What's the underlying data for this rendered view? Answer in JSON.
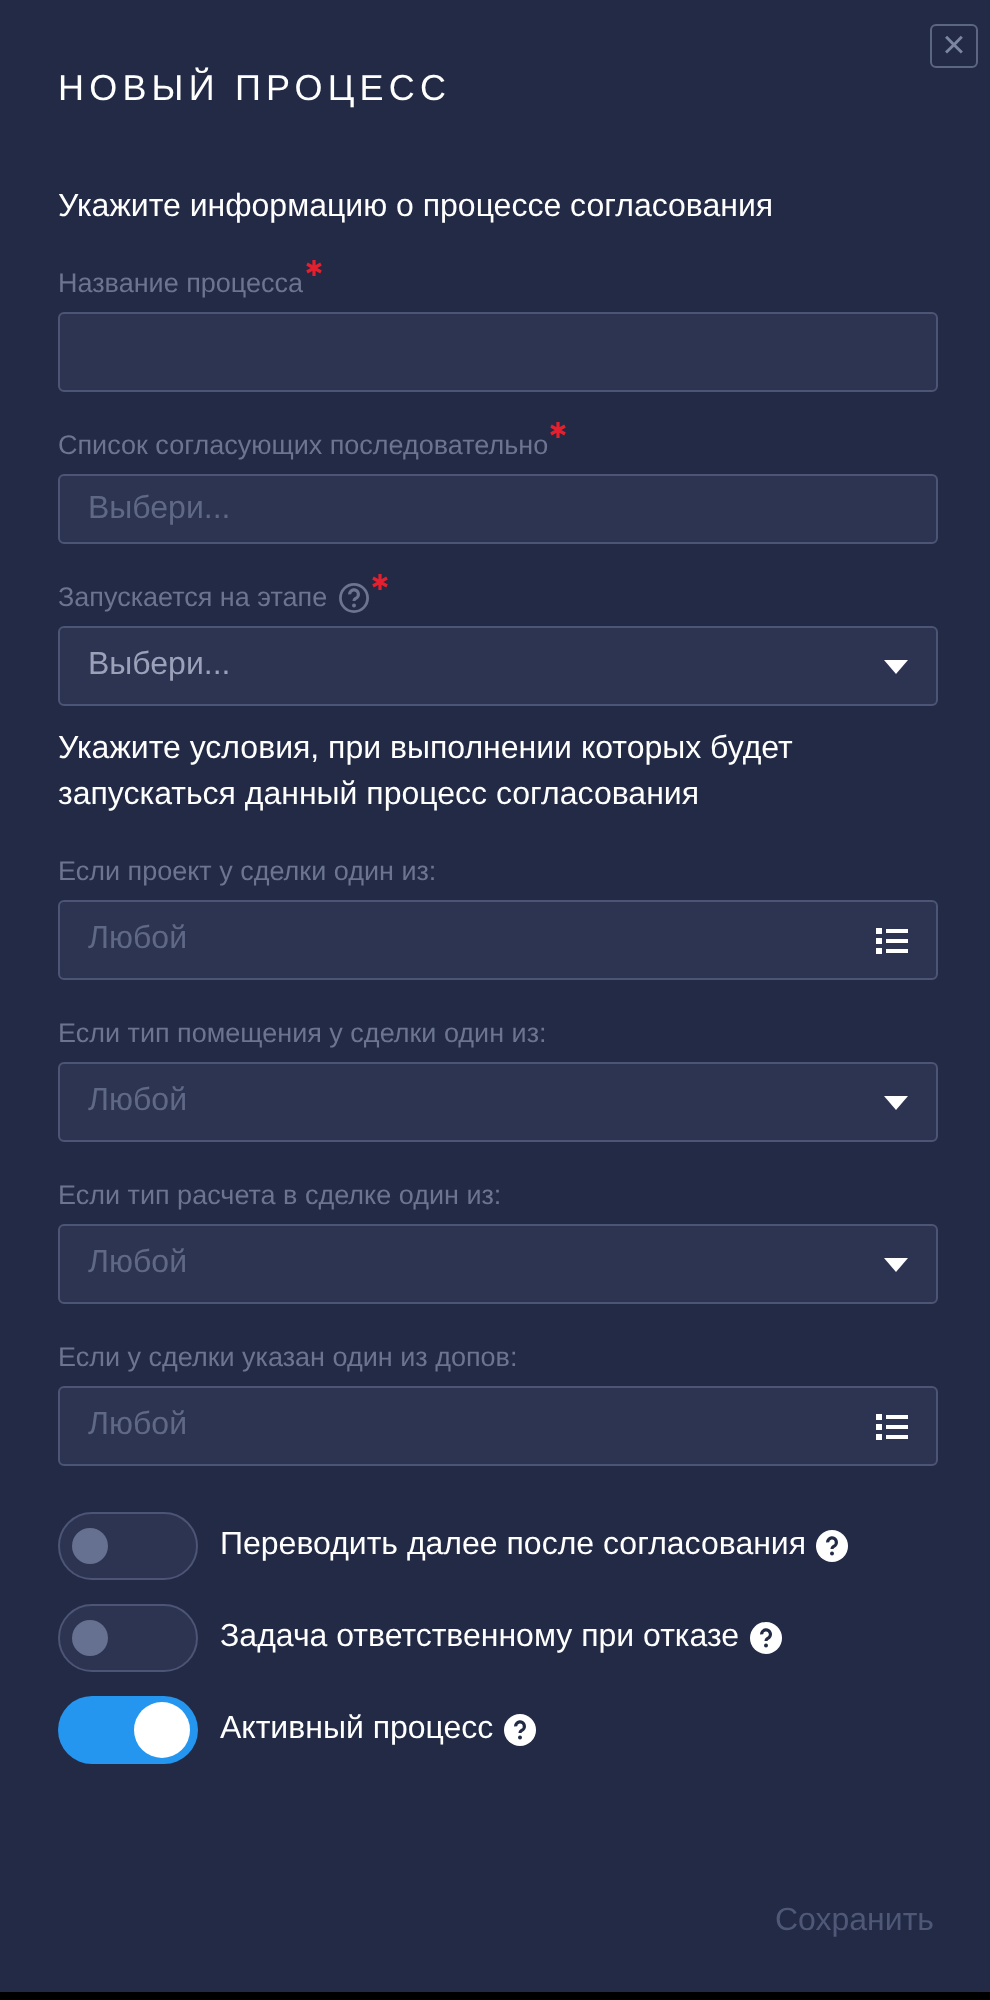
{
  "dialog": {
    "title": "НОВЫЙ ПРОЦЕСС",
    "close_label": "×"
  },
  "sections": [
    {
      "heading": "Укажите информацию о процессе согласования",
      "fields": [
        {
          "kind": "text",
          "label": "Название процесса",
          "required": true,
          "help": false
        },
        {
          "kind": "multi",
          "label": "Список согласующих последовательно",
          "required": true,
          "help": false,
          "placeholder": "Выбери..."
        },
        {
          "kind": "select",
          "label": "Запускается на этапе",
          "required": true,
          "help": true,
          "value": "Выбери..."
        }
      ]
    },
    {
      "heading": "Укажите условия, при выполнении которых будет запускаться данный процесс согласования",
      "fields": [
        {
          "kind": "list",
          "label": "Если проект у сделки один из:",
          "required": false,
          "help": false,
          "placeholder": "Любой"
        },
        {
          "kind": "select",
          "label": "Если тип помещения у сделки один из:",
          "required": false,
          "help": false,
          "placeholder": "Любой"
        },
        {
          "kind": "select",
          "label": "Если тип расчета в сделке один из:",
          "required": false,
          "help": false,
          "placeholder": "Любой"
        },
        {
          "kind": "list",
          "label": "Если у сделки указан один из допов:",
          "required": false,
          "help": false,
          "placeholder": "Любой"
        }
      ]
    }
  ],
  "toggles": [
    {
      "label": "Переводить далее после согласования",
      "on": false
    },
    {
      "label": "Задача ответственному при отказе",
      "on": false
    },
    {
      "label": "Активный процесс",
      "on": true
    }
  ],
  "save_button": {
    "label": "Сохранить",
    "disabled": true
  }
}
